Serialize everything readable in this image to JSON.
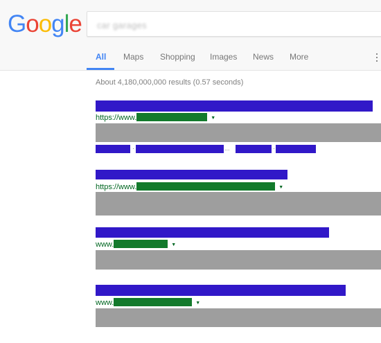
{
  "header": {
    "logo_letters": [
      {
        "char": "G",
        "color": "#4285f4"
      },
      {
        "char": "o",
        "color": "#ea4335"
      },
      {
        "char": "o",
        "color": "#fbbc05"
      },
      {
        "char": "g",
        "color": "#4285f4"
      },
      {
        "char": "l",
        "color": "#34a853"
      },
      {
        "char": "e",
        "color": "#ea4335"
      }
    ],
    "search_value": "car garages"
  },
  "tabs": [
    {
      "label": "All",
      "active": true
    },
    {
      "label": "Maps",
      "active": false
    },
    {
      "label": "Shopping",
      "active": false
    },
    {
      "label": "Images",
      "active": false
    },
    {
      "label": "News",
      "active": false
    },
    {
      "label": "More",
      "active": false
    }
  ],
  "stats": "About 4,180,000,000 results (0.57 seconds)",
  "results": [
    {
      "url_prefix": "https://www.",
      "has_sitelinks": true
    },
    {
      "url_prefix": "https://www.",
      "has_sitelinks": false
    },
    {
      "url_prefix": "www.",
      "has_sitelinks": false
    },
    {
      "url_prefix": "www.",
      "has_sitelinks": false
    }
  ],
  "colors": {
    "title_redaction": "#3118c8",
    "url_green": "#006621",
    "url_redaction": "#137a2c",
    "snippet_redaction": "#9e9e9e",
    "active_tab": "#4285f4"
  },
  "icons": {
    "url_dropdown": "triangle-down-icon",
    "more_options": "vertical-dots-icon"
  }
}
